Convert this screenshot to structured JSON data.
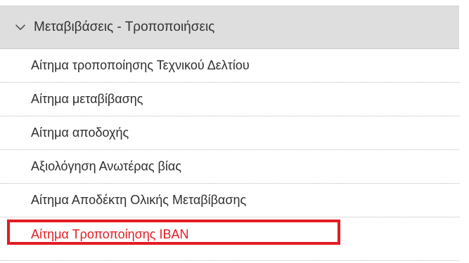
{
  "menu": {
    "header": {
      "title": "Μεταβιβάσεις - Τροποποιήσεις",
      "icon": "chevron-down-icon"
    },
    "items": [
      {
        "label": "Αίτημα τροποποίησης Τεχνικού Δελτίου"
      },
      {
        "label": "Αίτημα μεταβίβασης"
      },
      {
        "label": "Αίτημα αποδοχής"
      },
      {
        "label": "Αξιολόγηση Ανωτέρας βίας"
      },
      {
        "label": "Αίτημα Αποδέκτη Ολικής Μεταβίβασης"
      },
      {
        "label": "Αίτημα Τροποποίησης IBAN"
      }
    ],
    "active_color": "#e21c23",
    "highlight_color": "#e21c23",
    "header_background": "#dedede"
  }
}
